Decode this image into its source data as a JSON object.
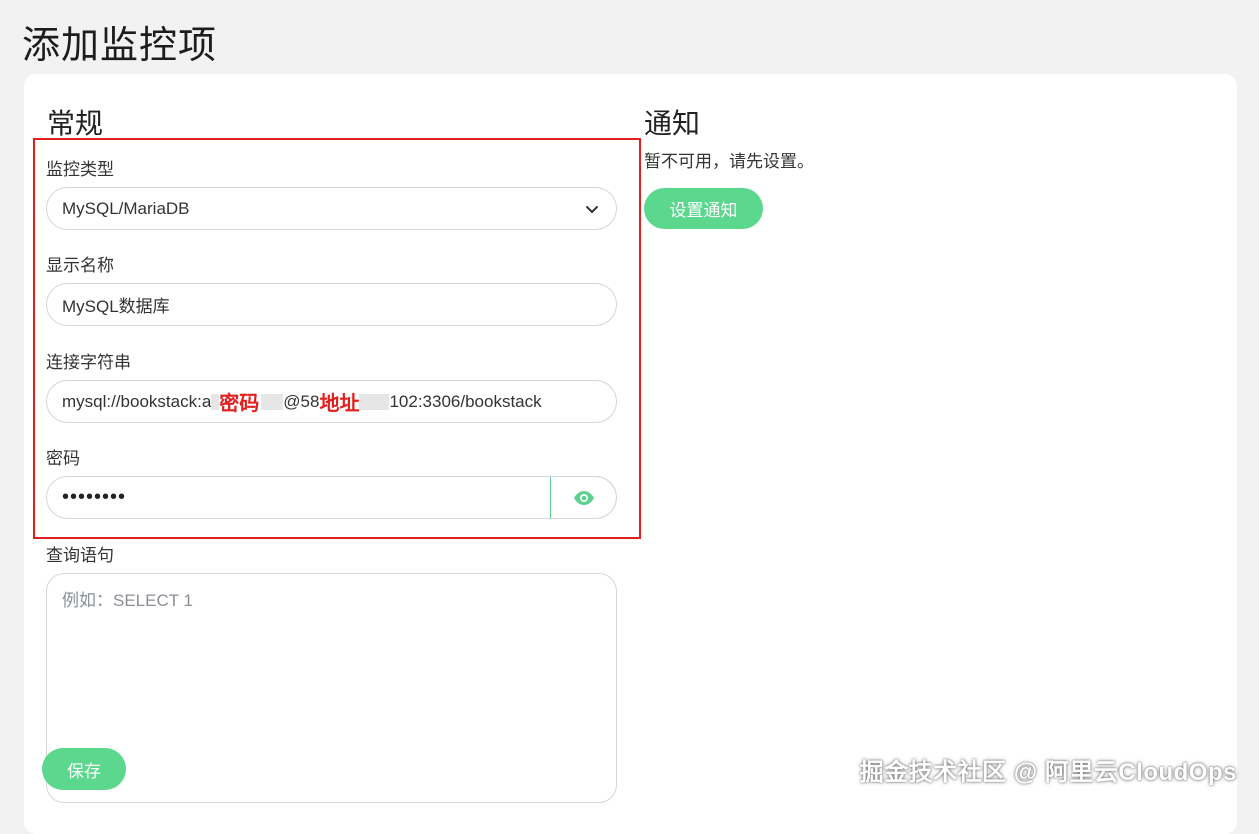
{
  "page_title": "添加监控项",
  "general": {
    "section_title": "常规",
    "monitor_type": {
      "label": "监控类型",
      "value": "MySQL/MariaDB"
    },
    "display_name": {
      "label": "显示名称",
      "value": "MySQL数据库"
    },
    "connection_string": {
      "label": "连接字符串",
      "prefix": "mysql://bookstack:a",
      "password_tag": "密码",
      "middle": "@58",
      "address_tag": "地址",
      "suffix": "102:3306/bookstack"
    },
    "password": {
      "label": "密码",
      "value": "••••••••",
      "toggle_icon": "eye-icon"
    },
    "query": {
      "label": "查询语句",
      "placeholder": "例如：SELECT 1"
    },
    "save_button": "保存"
  },
  "notification": {
    "section_title": "通知",
    "message": "暂不可用，请先设置。",
    "setup_button": "设置通知"
  },
  "watermark": "掘金技术社区 @ 阿里云CloudOps",
  "colors": {
    "accent": "#5cd88e",
    "highlight": "#e0201f"
  }
}
